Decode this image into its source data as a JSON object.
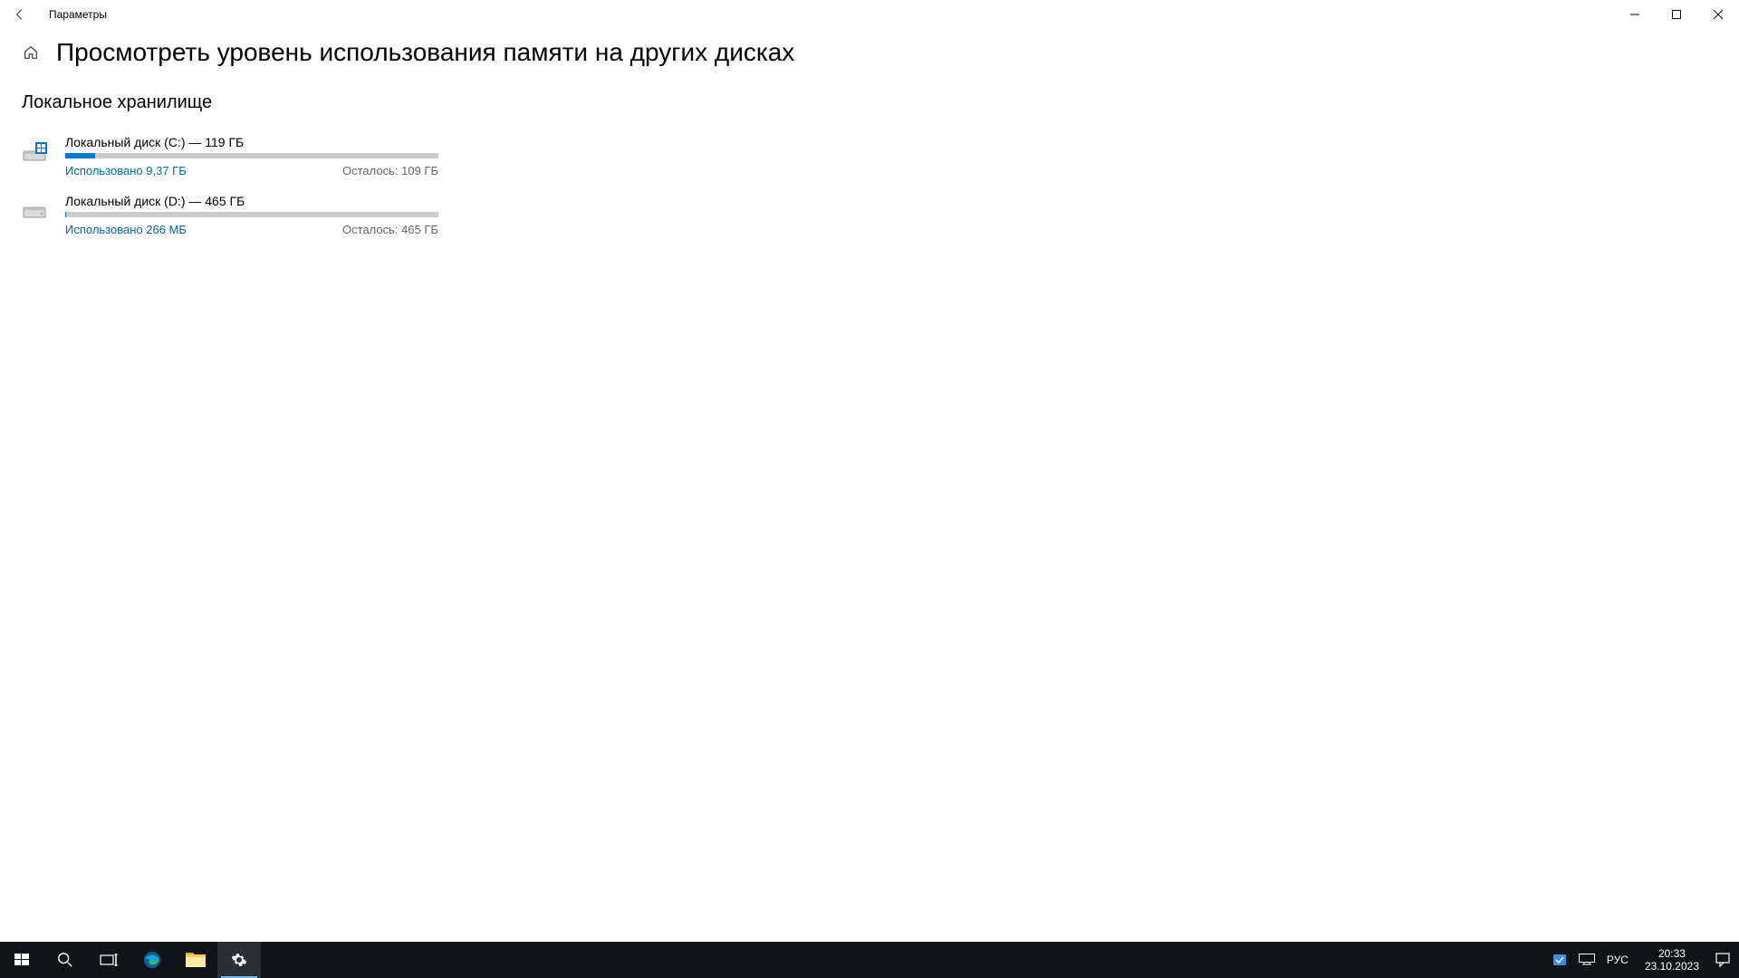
{
  "window": {
    "title": "Параметры",
    "page_title": "Просмотреть уровень использования памяти на других дисках",
    "section_title": "Локальное хранилище"
  },
  "disks": [
    {
      "name": "Локальный диск (C:) — 119 ГБ",
      "used_label": "Использовано 9,37 ГБ",
      "free_label": "Осталось: 109 ГБ",
      "percent": 8,
      "system": true
    },
    {
      "name": "Локальный диск (D:) — 465 ГБ",
      "used_label": "Использовано 266 МБ",
      "free_label": "Осталось: 465 ГБ",
      "percent": 0.3,
      "system": false
    }
  ],
  "taskbar": {
    "lang": "РУС",
    "time": "20:33",
    "date": "23.10.2023"
  }
}
